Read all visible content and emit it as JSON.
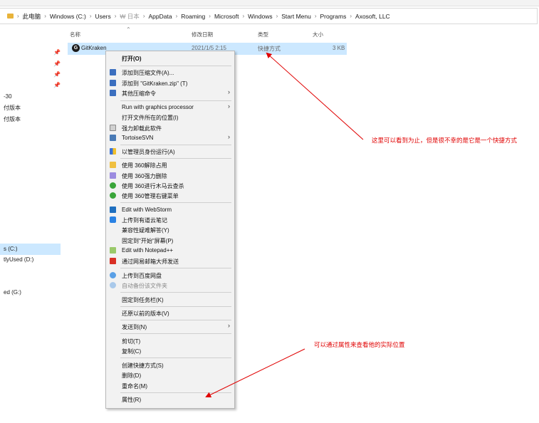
{
  "breadcrumb": {
    "items": [
      "此电脑",
      "Windows (C:)",
      "Users",
      "₩ 日本",
      "AppData",
      "Roaming",
      "Microsoft",
      "Windows",
      "Start Menu",
      "Programs",
      "Axosoft, LLC"
    ]
  },
  "columns": {
    "name": "名称",
    "modified": "修改日期",
    "type": "类型",
    "size": "大小"
  },
  "nav": {
    "items": [
      "-30",
      "付版本",
      "付版本",
      "s (C:)",
      "tlyUsed (D:)",
      "ed (G:)"
    ]
  },
  "file": {
    "name": "GitKraken",
    "modified": "2021/1/5 2:15",
    "type": "快捷方式",
    "size": "3 KB"
  },
  "context_menu": {
    "open": "打开(O)",
    "add_archive": "添加到压缩文件(A)...",
    "add_zip": "添加到 \"GitKraken.zip\" (T)",
    "other_compress": "其他压缩命令",
    "run_gpu": "Run with graphics processor",
    "open_location": "打开文件所在的位置(I)",
    "force_uninstall": "强力卸载此软件",
    "tortoise": "TortoiseSVN",
    "run_admin": "以管理员身份运行(A)",
    "unlock_360": "使用 360解除占用",
    "delete_360": "使用 360强力删除",
    "trojan_360": "使用 360进行木马云查杀",
    "menu_360": "使用 360管理右键菜单",
    "webstorm": "Edit with WebStorm",
    "youdao": "上传到有道云笔记",
    "compat": "兼容性疑难解答(Y)",
    "pin_start": "固定到\"开始\"屏幕(P)",
    "notepad": "Edit with Notepad++",
    "netease_mail": "通过网易邮箱大师发送",
    "baidu_upload": "上传到百度网盘",
    "baidu_backup": "自动备份该文件夹",
    "pin_taskbar": "固定到任务栏(K)",
    "restore": "还原以前的版本(V)",
    "send_to": "发送到(N)",
    "cut": "剪切(T)",
    "copy": "复制(C)",
    "create_shortcut": "创建快捷方式(S)",
    "delete": "删除(D)",
    "rename": "重命名(M)",
    "properties": "属性(R)"
  },
  "annotations": {
    "note1": "这里可以看到为止，但是很不幸的是它是一个快捷方式",
    "note2": "可以通过属性来查看他的实际位置"
  },
  "colors": {
    "selection": "#cce8ff",
    "annotation": "#e00000",
    "menu_bg": "#f2f2f2"
  }
}
